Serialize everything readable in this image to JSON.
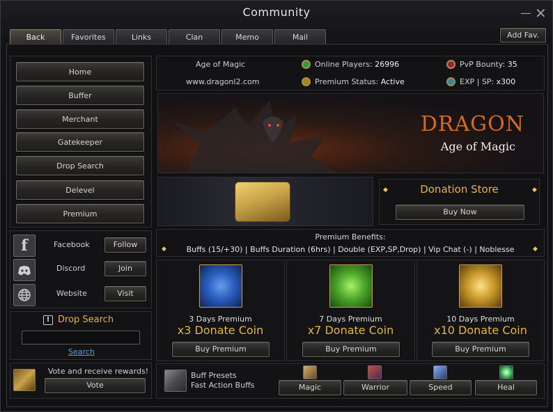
{
  "window": {
    "title": "Community"
  },
  "tabs": [
    {
      "label": "Back"
    },
    {
      "label": "Favorites"
    },
    {
      "label": "Links"
    },
    {
      "label": "Clan"
    },
    {
      "label": "Memo"
    },
    {
      "label": "Mail"
    }
  ],
  "add_fav_label": "Add Fav.",
  "sidebar": {
    "items": [
      {
        "label": "Home"
      },
      {
        "label": "Buffer"
      },
      {
        "label": "Merchant"
      },
      {
        "label": "Gatekeeper"
      },
      {
        "label": "Drop Search"
      },
      {
        "label": "Delevel"
      },
      {
        "label": "Premium"
      }
    ]
  },
  "social": [
    {
      "name": "Facebook",
      "action": "Follow",
      "icon": "facebook-icon"
    },
    {
      "name": "Discord",
      "action": "Join",
      "icon": "discord-icon"
    },
    {
      "name": "Website",
      "action": "Visit",
      "icon": "globe-icon"
    }
  ],
  "drop_search": {
    "title": "Drop Search",
    "input_value": "",
    "link": "Search"
  },
  "vote": {
    "text": "Vote and receive rewards!",
    "button": "Vote"
  },
  "server": {
    "name": "Age of Magic",
    "website": "www.dragonl2.com",
    "online_label": "Online Players:",
    "online_value": "26996",
    "premium_label": "Premium Status:",
    "premium_value": "Active",
    "pvp_label": "PvP Bounty:",
    "pvp_value": "35",
    "exp_label": "EXP | SP:",
    "exp_value": "x300"
  },
  "banner": {
    "title": "DRAGON",
    "subtitle": "Age of Magic"
  },
  "donation": {
    "title": "Donation Store",
    "button": "Buy Now"
  },
  "benefits": {
    "title": "Premium Benefits:",
    "text": "Buffs (15/+30) | Buffs Duration (6hrs) | Double (EXP,SP,Drop) | Vip Chat (-) | Noblesse"
  },
  "premium_packages": [
    {
      "days": "3 Days Premium",
      "reward": "x3 Donate Coin",
      "button": "Buy Premium",
      "color": "#2a5fbf"
    },
    {
      "days": "7 Days Premium",
      "reward": "x7 Donate Coin",
      "button": "Buy Premium",
      "color": "#4fa82a"
    },
    {
      "days": "10 Days Premium",
      "reward": "x10 Donate Coin",
      "button": "Buy Premium",
      "color": "#c99a2a"
    }
  ],
  "buffs": {
    "title": "Buff Presets",
    "subtitle": "Fast Action Buffs",
    "presets": [
      {
        "label": "Magic"
      },
      {
        "label": "Warrior"
      },
      {
        "label": "Speed"
      },
      {
        "label": "Heal"
      }
    ]
  },
  "colors": {
    "accent": "#e8b43a",
    "online_dot": "#2f9a3a",
    "pvp_dot": "#a02040",
    "premium_dot": "#a08a20",
    "exp_dot": "#2a8aa0"
  }
}
